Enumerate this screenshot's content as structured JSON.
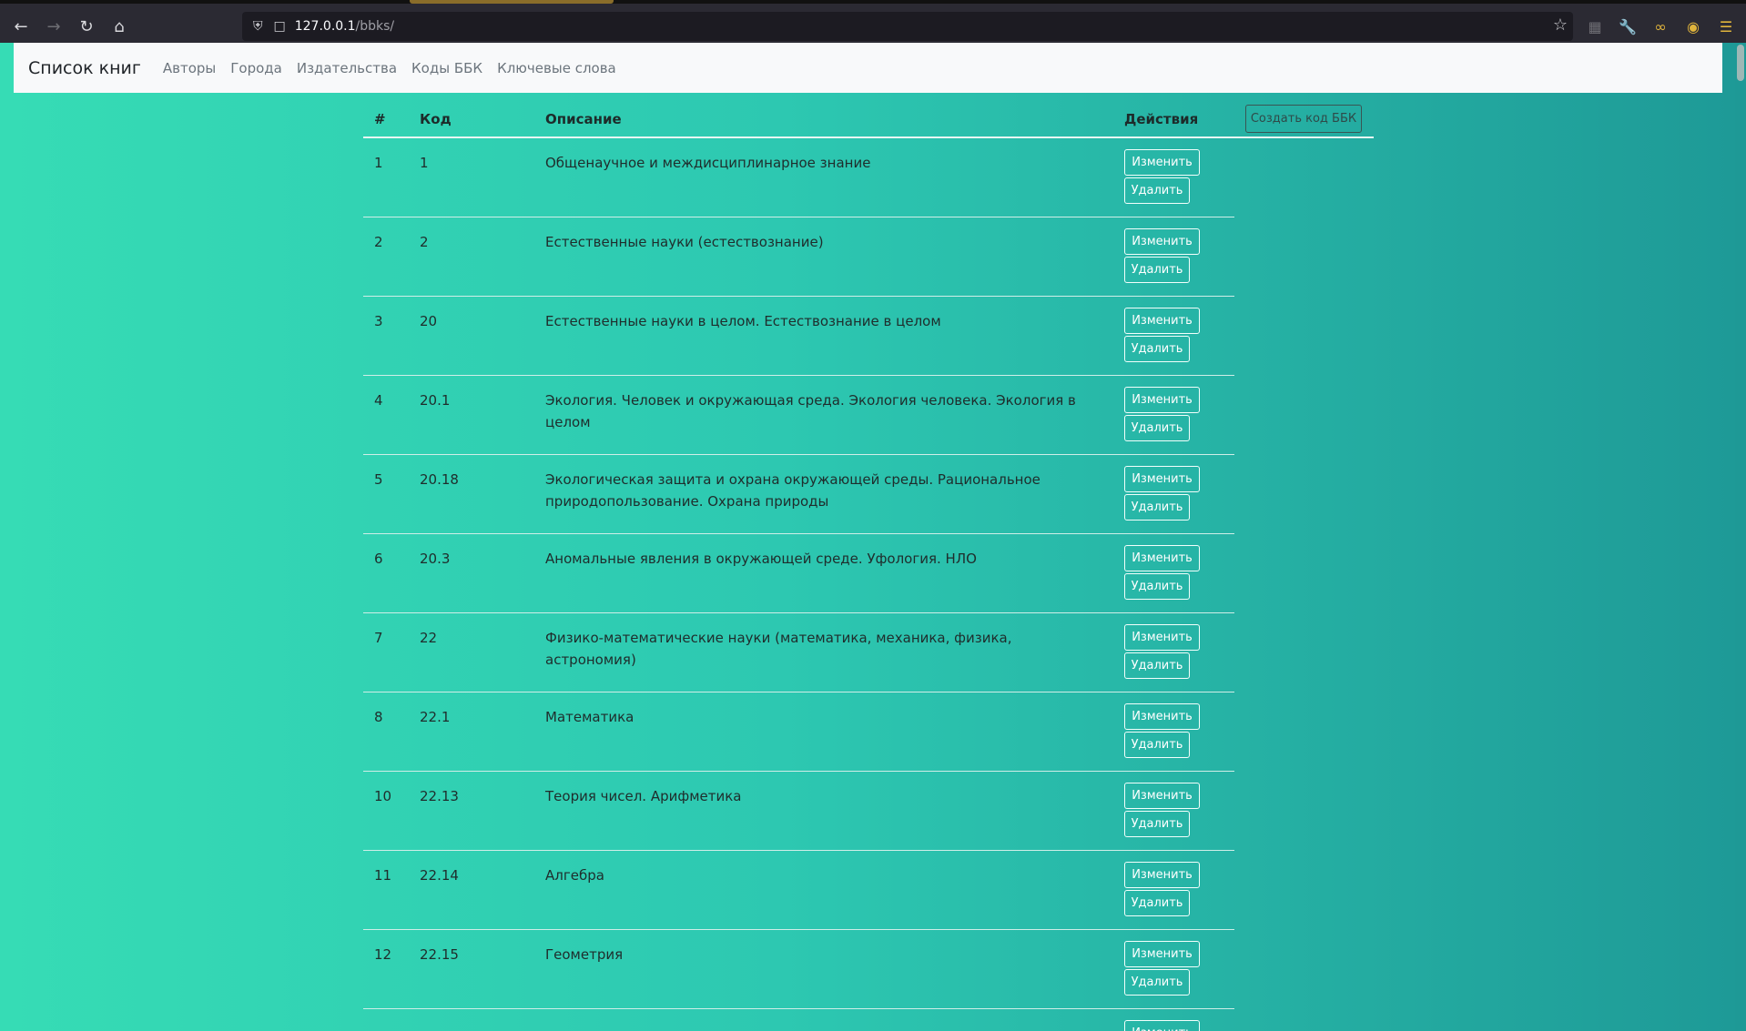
{
  "browser": {
    "url_host": "127.0.0.1",
    "url_path": "/bbks/"
  },
  "navbar": {
    "brand": "Список книг",
    "links": [
      "Авторы",
      "Города",
      "Издательства",
      "Коды ББК",
      "Ключевые слова"
    ]
  },
  "actions": {
    "create_label": "Создать код ББК"
  },
  "table": {
    "headers": {
      "num": "#",
      "code": "Код",
      "desc": "Описание",
      "actions": "Действия"
    },
    "edit_label": "Изменить",
    "delete_label": "Удалить",
    "rows": [
      {
        "num": "1",
        "code": "1",
        "desc": "Общенаучное и междисциплинарное знание"
      },
      {
        "num": "2",
        "code": "2",
        "desc": "Естественные науки (естествознание)"
      },
      {
        "num": "3",
        "code": "20",
        "desc": "Естественные науки в целом. Естествознание в целом"
      },
      {
        "num": "4",
        "code": "20.1",
        "desc": "Экология. Человек и окружающая среда. Экология человека. Экология в целом"
      },
      {
        "num": "5",
        "code": "20.18",
        "desc": "Экологическая защита и охрана окружающей среды. Рациональное природопользование. Охрана природы"
      },
      {
        "num": "6",
        "code": "20.3",
        "desc": "Аномальные явления в окружающей среде. Уфология. НЛО"
      },
      {
        "num": "7",
        "code": "22",
        "desc": "Физико-математические науки (математика, механика, физика, астрономия)"
      },
      {
        "num": "8",
        "code": "22.1",
        "desc": "Математика"
      },
      {
        "num": "10",
        "code": "22.13",
        "desc": "Теория чисел. Арифметика"
      },
      {
        "num": "11",
        "code": "22.14",
        "desc": "Алгебра"
      },
      {
        "num": "12",
        "code": "22.15",
        "desc": "Геометрия"
      }
    ]
  }
}
